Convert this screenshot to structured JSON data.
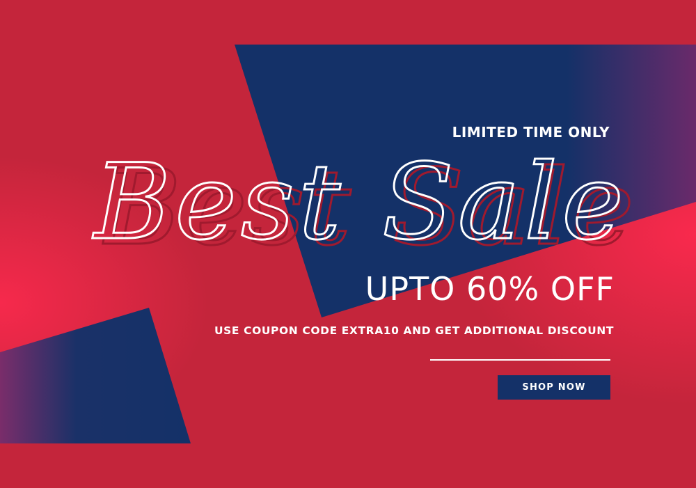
{
  "banner": {
    "tagline": "LIMITED TIME ONLY",
    "script_title": "Best Sale",
    "headline": "UPTO 60% OFF",
    "coupon_text": "USE COUPON CODE EXTRA10 AND GET ADDITIONAL DISCOUNT",
    "cta_label": "SHOP NOW"
  },
  "colors": {
    "background_red": "#c4253b",
    "panel_navy": "#143168",
    "glow_pink": "#ff2a4f",
    "text": "#ffffff"
  }
}
